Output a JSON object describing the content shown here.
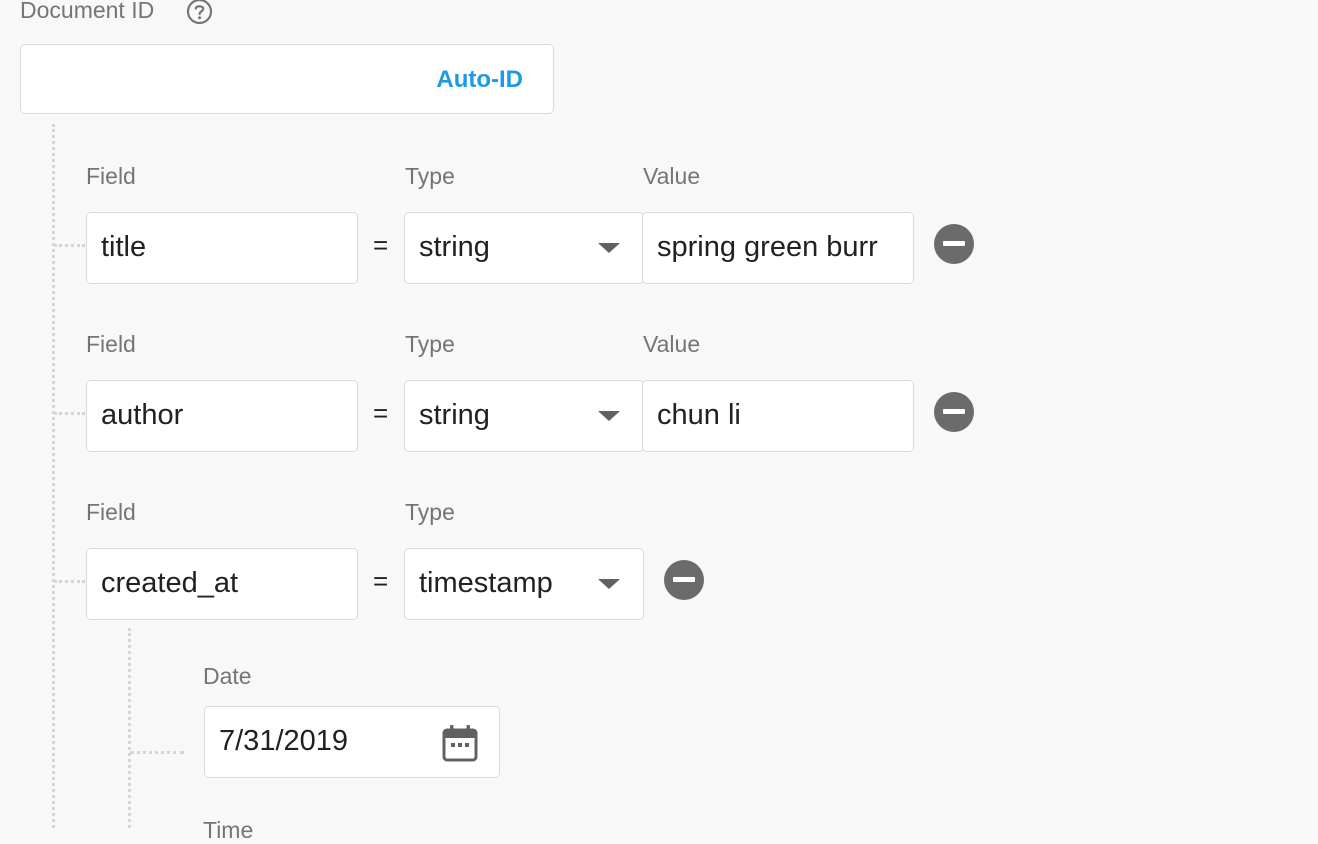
{
  "document": {
    "id_label": "Document ID",
    "help_icon": "help-circle-icon",
    "auto_id_label": "Auto-ID"
  },
  "column_labels": {
    "field": "Field",
    "type": "Type",
    "value": "Value"
  },
  "equals_sign": "=",
  "fields": [
    {
      "name": "title",
      "type": "string",
      "value": "spring green burr"
    },
    {
      "name": "author",
      "type": "string",
      "value": "chun li"
    },
    {
      "name": "created_at",
      "type": "timestamp"
    }
  ],
  "timestamp": {
    "date_label": "Date",
    "date_value": "7/31/2019",
    "time_label": "Time",
    "calendar_icon": "calendar-icon"
  },
  "icons": {
    "remove": "remove-circle-icon",
    "dropdown": "caret-down-icon"
  },
  "colors": {
    "accent": "#1e9be0",
    "remove_button": "#6b6b6b",
    "border": "#dadada",
    "background": "#f8f8f8"
  }
}
